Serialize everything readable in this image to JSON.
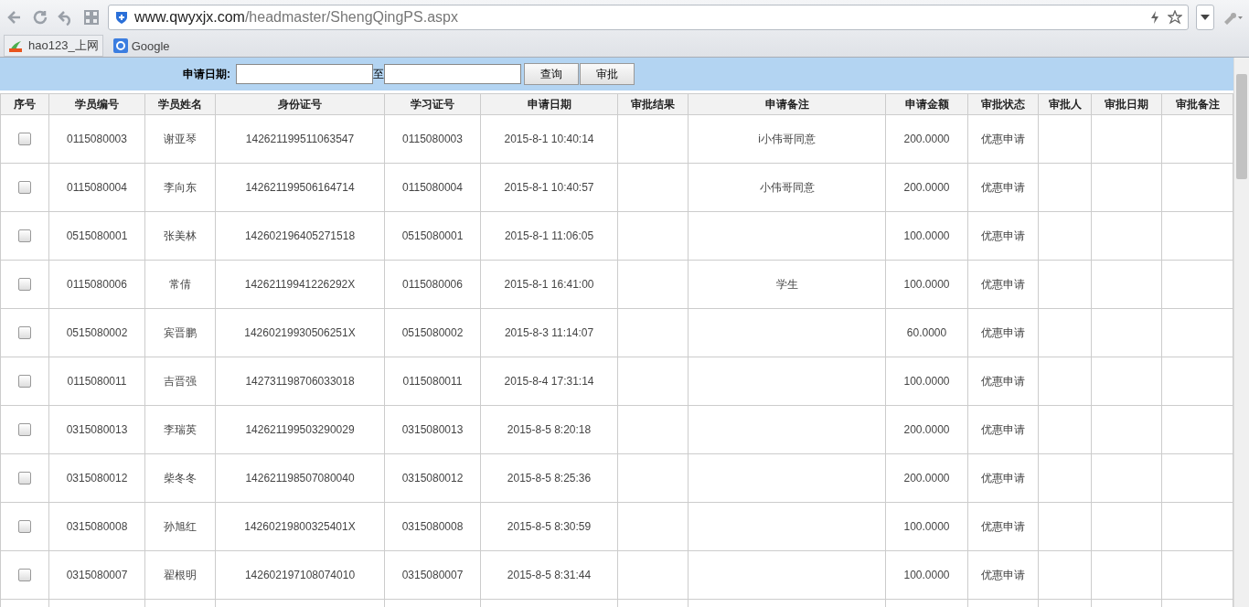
{
  "browser": {
    "address_host": "www.qwyxjx.com",
    "address_path": "/headmaster/ShengQingPS.aspx",
    "bookmarks": [
      "hao123_上网",
      "Google"
    ]
  },
  "filter": {
    "label": "申请日期:",
    "separator": "至",
    "buttons": [
      "查询",
      "审批"
    ]
  },
  "table": {
    "columns": [
      "序号",
      "学员编号",
      "学员姓名",
      "身份证号",
      "学习证号",
      "申请日期",
      "审批结果",
      "申请备注",
      "申请金额",
      "审批状态",
      "审批人",
      "审批日期",
      "审批备注"
    ],
    "rows": [
      {
        "checked": false,
        "cells": [
          "",
          "0115080003",
          "谢亚琴",
          "142621199511063547",
          "0115080003",
          "2015-8-1 10:40:14",
          null,
          "i小伟哥同意",
          "200.0000",
          "优惠申请",
          null,
          null,
          null
        ]
      },
      {
        "checked": false,
        "cells": [
          "",
          "0115080004",
          "李向东",
          "142621199506164714",
          "0115080004",
          "2015-8-1 10:40:57",
          null,
          "小伟哥同意",
          "200.0000",
          "优惠申请",
          null,
          null,
          null
        ]
      },
      {
        "checked": false,
        "cells": [
          "",
          "0515080001",
          "张美林",
          "142602196405271518",
          "0515080001",
          "2015-8-1 11:06:05",
          null,
          null,
          "100.0000",
          "优惠申请",
          null,
          null,
          null
        ]
      },
      {
        "checked": false,
        "cells": [
          "",
          "0115080006",
          "常倩",
          "14262119941226292X",
          "0115080006",
          "2015-8-1 16:41:00",
          null,
          "学生",
          "100.0000",
          "优惠申请",
          null,
          null,
          null
        ]
      },
      {
        "checked": false,
        "cells": [
          "",
          "0515080002",
          "宾晋鹏",
          "14260219930506251X",
          "0515080002",
          "2015-8-3 11:14:07",
          null,
          null,
          "60.0000",
          "优惠申请",
          null,
          null,
          null
        ]
      },
      {
        "checked": false,
        "cells": [
          "",
          "0115080011",
          "吉晋强",
          "142731198706033018",
          "0115080011",
          "2015-8-4 17:31:14",
          null,
          null,
          "100.0000",
          "优惠申请",
          null,
          null,
          null
        ]
      },
      {
        "checked": false,
        "cells": [
          "",
          "0315080013",
          "李瑞英",
          "142621199503290029",
          "0315080013",
          "2015-8-5 8:20:18",
          null,
          null,
          "200.0000",
          "优惠申请",
          null,
          null,
          null
        ]
      },
      {
        "checked": false,
        "cells": [
          "",
          "0315080012",
          "柴冬冬",
          "142621198507080040",
          "0315080012",
          "2015-8-5 8:25:36",
          null,
          null,
          "200.0000",
          "优惠申请",
          null,
          null,
          null
        ]
      },
      {
        "checked": false,
        "cells": [
          "",
          "0315080008",
          "孙旭红",
          "14260219800325401X",
          "0315080008",
          "2015-8-5 8:30:59",
          null,
          null,
          "100.0000",
          "优惠申请",
          null,
          null,
          null
        ]
      },
      {
        "checked": false,
        "cells": [
          "",
          "0315080007",
          "翟根明",
          "142602197108074010",
          "0315080007",
          "2015-8-5 8:31:44",
          null,
          null,
          "100.0000",
          "优惠申请",
          null,
          null,
          null
        ]
      }
    ]
  }
}
